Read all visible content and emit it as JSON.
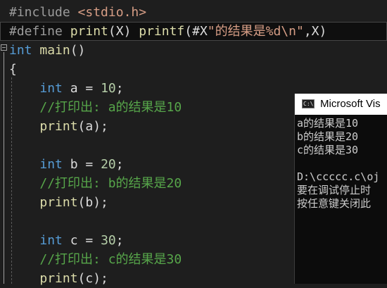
{
  "editor": {
    "lines": [
      [
        {
          "t": "#include ",
          "c": "pp"
        },
        {
          "t": "<stdio.h>",
          "c": "str"
        }
      ],
      [
        {
          "t": "#define ",
          "c": "pp"
        },
        {
          "t": "print",
          "c": "fn"
        },
        {
          "t": "(X) ",
          "c": "def"
        },
        {
          "t": "printf",
          "c": "fn"
        },
        {
          "t": "(#X",
          "c": "def"
        },
        {
          "t": "\"的结果是%d\\n\"",
          "c": "str"
        },
        {
          "t": ",X)",
          "c": "def"
        }
      ],
      [
        {
          "t": "int",
          "c": "kw"
        },
        {
          "t": " ",
          "c": "def"
        },
        {
          "t": "main",
          "c": "fn"
        },
        {
          "t": "()",
          "c": "def"
        }
      ],
      [
        {
          "t": "{",
          "c": "def"
        }
      ],
      [
        {
          "t": "    ",
          "c": "def"
        },
        {
          "t": "int",
          "c": "kw"
        },
        {
          "t": " a = ",
          "c": "def"
        },
        {
          "t": "10",
          "c": "num"
        },
        {
          "t": ";",
          "c": "def"
        }
      ],
      [
        {
          "t": "    ",
          "c": "def"
        },
        {
          "t": "//打印出: a的结果是10",
          "c": "cm"
        }
      ],
      [
        {
          "t": "    ",
          "c": "def"
        },
        {
          "t": "print",
          "c": "fn"
        },
        {
          "t": "(a);",
          "c": "def"
        }
      ],
      [],
      [
        {
          "t": "    ",
          "c": "def"
        },
        {
          "t": "int",
          "c": "kw"
        },
        {
          "t": " b = ",
          "c": "def"
        },
        {
          "t": "20",
          "c": "num"
        },
        {
          "t": ";",
          "c": "def"
        }
      ],
      [
        {
          "t": "    ",
          "c": "def"
        },
        {
          "t": "//打印出: b的结果是20",
          "c": "cm"
        }
      ],
      [
        {
          "t": "    ",
          "c": "def"
        },
        {
          "t": "print",
          "c": "fn"
        },
        {
          "t": "(b);",
          "c": "def"
        }
      ],
      [],
      [
        {
          "t": "    ",
          "c": "def"
        },
        {
          "t": "int",
          "c": "kw"
        },
        {
          "t": " c = ",
          "c": "def"
        },
        {
          "t": "30",
          "c": "num"
        },
        {
          "t": ";",
          "c": "def"
        }
      ],
      [
        {
          "t": "    ",
          "c": "def"
        },
        {
          "t": "//打印出: c的结果是30",
          "c": "cm"
        }
      ],
      [
        {
          "t": "    ",
          "c": "def"
        },
        {
          "t": "print",
          "c": "fn"
        },
        {
          "t": "(c);",
          "c": "def"
        }
      ]
    ],
    "highlighted_line": 1
  },
  "console": {
    "title": "Microsoft Vis",
    "icon_text": "C:\\",
    "output": [
      "a的结果是10",
      "b的结果是20",
      "c的结果是30",
      "",
      "D:\\ccccc.c\\oj",
      "要在调试停止时",
      "按任意键关闭此"
    ]
  },
  "colors": {
    "editor_bg": "#1e1e1e",
    "keyword": "#569cd6",
    "function": "#dcdcaa",
    "string": "#d69d85",
    "comment": "#57a64a",
    "number": "#b5cea8",
    "preprocessor": "#9b9b9b",
    "console_bg": "#0c0c0c"
  }
}
